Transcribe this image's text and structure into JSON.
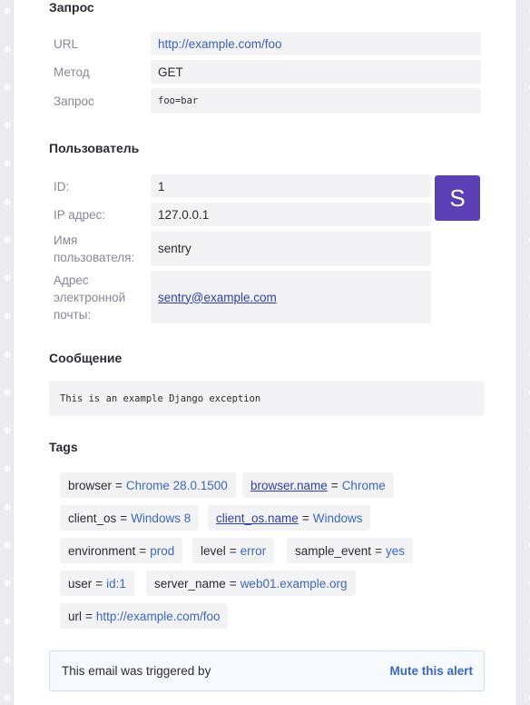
{
  "request": {
    "heading": "Запрос",
    "rows": [
      {
        "key": "URL",
        "value": "http://example.com/foo"
      },
      {
        "key": "Метод",
        "value": "GET"
      },
      {
        "key": "Запрос",
        "value": "foo=bar"
      }
    ]
  },
  "user": {
    "heading": "Пользователь",
    "avatar_letter": "S",
    "avatar_color": "#5b3fb4",
    "rows": [
      {
        "key": "ID:",
        "value": "1"
      },
      {
        "key": "IP адрес:",
        "value": "127.0.0.1"
      },
      {
        "key": "Имя пользователя:",
        "value": "sentry"
      },
      {
        "key": "Адрес электронной почты:",
        "value": "sentry@example.com"
      }
    ]
  },
  "message": {
    "heading": "Сообщение",
    "text": "This is an example Django exception"
  },
  "tags": {
    "heading": "Tags",
    "items": [
      {
        "key": "browser",
        "value": "Chrome 28.0.1500"
      },
      {
        "key": "browser.name",
        "value": "Chrome"
      },
      {
        "key": "client_os",
        "value": "Windows 8"
      },
      {
        "key": "client_os.name",
        "value": "Windows"
      },
      {
        "key": "environment",
        "value": "prod"
      },
      {
        "key": "level",
        "value": "error"
      },
      {
        "key": "sample_event",
        "value": "yes"
      },
      {
        "key": "user",
        "value": "id:1"
      },
      {
        "key": "server_name",
        "value": "web01.example.org"
      },
      {
        "key": "url",
        "value": "http://example.com/foo"
      }
    ],
    "equals": "="
  },
  "alert": {
    "text": "This email was triggered by",
    "mute_label": "Mute this alert"
  },
  "colors": {
    "link": "#3b68c0",
    "avatar": "#5b3fb4"
  }
}
